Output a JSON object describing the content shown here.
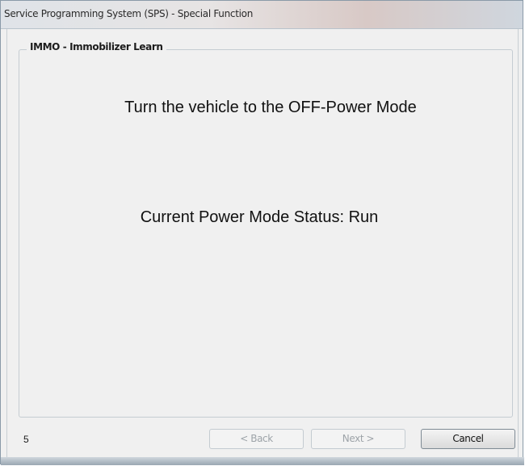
{
  "window": {
    "title": "Service Programming System (SPS) - Special Function"
  },
  "group": {
    "title": "IMMO - Immobilizer Learn"
  },
  "content": {
    "instruction": "Turn the vehicle to the OFF-Power Mode",
    "status": "Current Power Mode Status: Run"
  },
  "footer": {
    "step_number": "5",
    "back_label": "< Back",
    "next_label": "Next >",
    "cancel_label": "Cancel"
  }
}
